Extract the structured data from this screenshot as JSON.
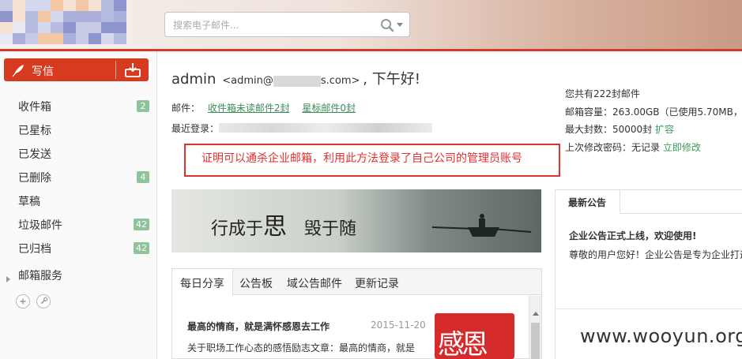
{
  "search": {
    "placeholder": "搜索电子邮件..."
  },
  "sidebar": {
    "compose_label": "写信",
    "items": [
      {
        "label": "收件箱",
        "badge": "2"
      },
      {
        "label": "已星标",
        "badge": null
      },
      {
        "label": "已发送",
        "badge": null
      },
      {
        "label": "已删除",
        "badge": "4"
      },
      {
        "label": "草稿",
        "badge": null
      },
      {
        "label": "垃圾邮件",
        "badge": "42"
      },
      {
        "label": "已归档",
        "badge": "42"
      }
    ],
    "services_label": "邮箱服务"
  },
  "greeting": {
    "name": "admin",
    "email_prefix": "<admin@",
    "email_suffix": "s.com>",
    "hello": ", 下午好!"
  },
  "mail_summary": {
    "label": "邮件：",
    "unread_link": "收件箱未读邮件2封",
    "starred_link": "星标邮件0封"
  },
  "last_login": {
    "label": "最近登录："
  },
  "annotation": {
    "text": "证明可以通杀企业邮箱，利用此方法登录了自己公司的管理员账号"
  },
  "banner": {
    "text_a": "行成于",
    "text_big": "思",
    "text_b": "毁于随"
  },
  "tabs": {
    "items": [
      "每日分享",
      "公告板",
      "域公告邮件",
      "更新记录"
    ],
    "article": {
      "title": "最高的情商，就是满怀感恩去工作",
      "date": "2015-11-20",
      "body": "关于职场工作心态的感悟励志文章：最高的情商，就是",
      "image_text": "感恩"
    }
  },
  "stats": {
    "total": "您共有222封邮件",
    "capacity": "邮箱容量：263.00GB（已使用5.70MB，",
    "max_label": "最大封数：50000封",
    "expand_link": "扩容",
    "pwd_label": "上次修改密码：无记录",
    "pwd_link": "立即修改"
  },
  "notice": {
    "tab_label": "最新公告",
    "headline": "企业公告正式上线，欢迎使用!",
    "body": "尊敬的用户您好！企业公告是专为企业打造"
  },
  "watermark": {
    "text": "www.wooyun.org"
  },
  "colors": {
    "accent": "#d63a1f",
    "link": "#3d8b5a",
    "badge": "#8fc39a",
    "annotation": "#e03131"
  }
}
